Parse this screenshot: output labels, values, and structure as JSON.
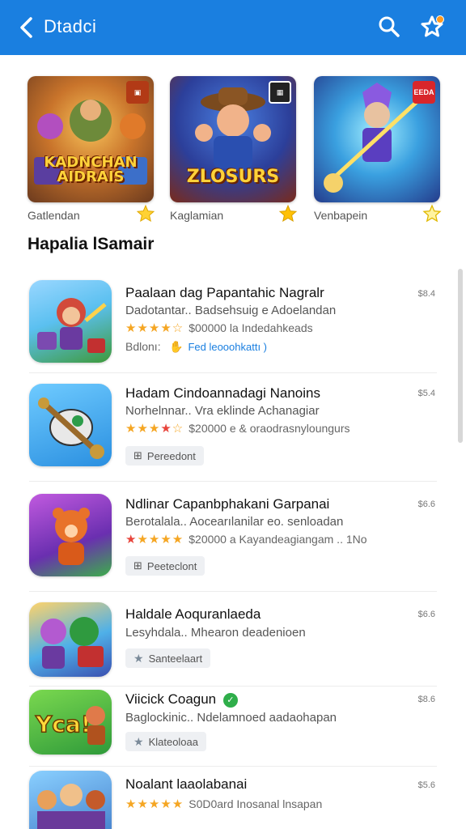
{
  "header": {
    "title": "Dtadci",
    "colors": {
      "bar": "#1a7fe0",
      "notification_dot": "#ff9a1f"
    }
  },
  "featured": [
    {
      "art_title": "KADNCHAN AIDRAIS",
      "label": "Gatlendan"
    },
    {
      "art_title": "ZLOSURS",
      "label": "Kaglamian"
    },
    {
      "art_title": "",
      "label": "Venbapein",
      "badge": "EEDA"
    }
  ],
  "section_title": "Hapalia lSamair",
  "apps": [
    {
      "name": "Paalaan dag Papantahic Nagralr",
      "subtitle": "Dadotantar.. Badsehsuig e Adoelandan",
      "rating_text": "$00000 la Indedahkeads",
      "size": "$8.4",
      "prefix": "Bdlonı:",
      "chip": "Fed leooohkattı )"
    },
    {
      "name": "Hadam Cindoannadagi Nanoins",
      "subtitle": "Norhelnnar.. Vra eklinde Achanagiar",
      "rating_text": "$20000 e & oraodrasnyloungurs",
      "size": "$5.4",
      "chip": "Pereedont"
    },
    {
      "name": "Ndlinar Capanbphakani Garpanai",
      "subtitle": "Berotalala.. Aocearılanilar eo. senloadan",
      "rating_text": "$20000 a Kayandeagiangam .. 1No",
      "size": "$6.6",
      "chip": "Peeteclont"
    },
    {
      "name": "Haldale Aoquranlaeda",
      "subtitle": "Lesyhdala.. Mhearon deadenioen",
      "size": "$6.6",
      "chip": "Santeelaart"
    },
    {
      "name": "Viicick Coagun",
      "subtitle": "Baglockinic.. Ndelamnoed aadaohapan",
      "size": "$8.6",
      "chip": "Klateoloaa"
    },
    {
      "name": "Noalant laaolabanai",
      "rating_text": "S0D0ard Inosanal lnsapan",
      "size": "$5.6"
    }
  ]
}
